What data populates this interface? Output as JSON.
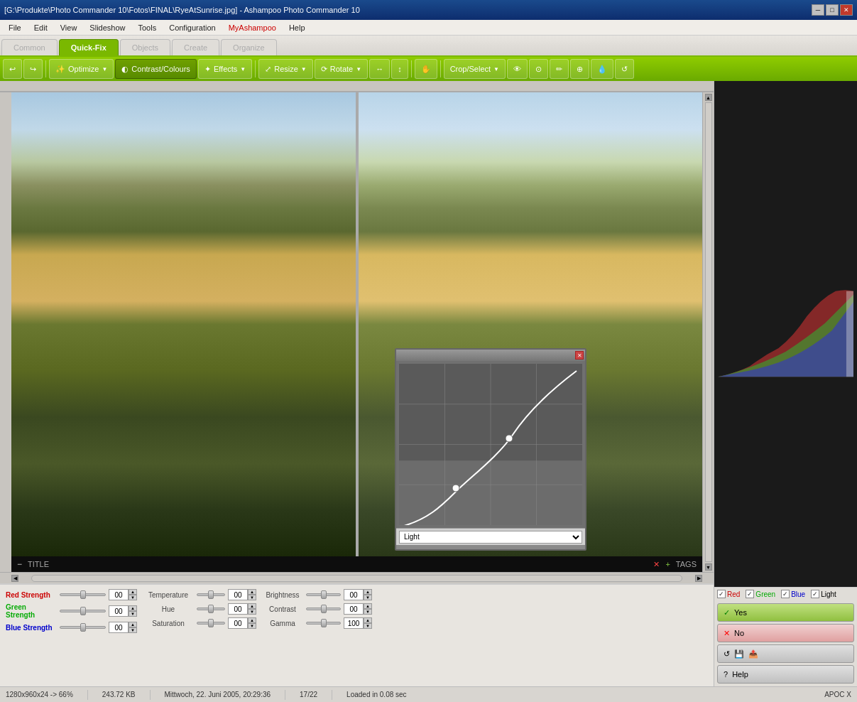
{
  "titlebar": {
    "text": "[G:\\Produkte\\Photo Commander 10\\Fotos\\FINAL\\RyeAtSunrise.jpg] - Ashampoo Photo Commander 10",
    "min": "─",
    "max": "□",
    "close": "✕"
  },
  "menubar": {
    "items": [
      "File",
      "Edit",
      "View",
      "Slideshow",
      "Tools",
      "Configuration",
      "MyAshampoo",
      "Help"
    ],
    "special_index": 6
  },
  "tabs": {
    "items": [
      "Common",
      "Quick-Fix",
      "Objects",
      "Create",
      "Organize"
    ],
    "active": 1
  },
  "toolbar": {
    "undo_icon": "↩",
    "redo_icon": "↪",
    "optimize": "Optimize",
    "contrast_colours": "Contrast/Colours",
    "effects": "Effects",
    "resize": "Resize",
    "rotate": "Rotate",
    "crop": "Crop/Select"
  },
  "sliders": {
    "red_strength": {
      "label": "Red Strength",
      "value": "00"
    },
    "green_strength": {
      "label": "Green Strength",
      "value": "00"
    },
    "blue_strength": {
      "label": "Blue Strength",
      "value": "00"
    },
    "temperature": {
      "label": "Temperature",
      "value": "00"
    },
    "hue": {
      "label": "Hue",
      "value": "00"
    },
    "saturation": {
      "label": "Saturation",
      "value": "00"
    },
    "brightness": {
      "label": "Brightness",
      "value": "00"
    },
    "contrast": {
      "label": "Contrast",
      "value": "00"
    },
    "gamma": {
      "label": "Gamma",
      "value": "100"
    }
  },
  "curves": {
    "dropdown_value": "Light",
    "close_icon": "✕"
  },
  "checkboxes": {
    "red": {
      "label": "Red",
      "checked": true
    },
    "green": {
      "label": "Green",
      "checked": true
    },
    "blue": {
      "label": "Blue",
      "checked": true
    },
    "light": {
      "label": "Light",
      "checked": true
    }
  },
  "action_buttons": {
    "yes": "Yes",
    "no": "No",
    "reset_icon": "↺",
    "save_icon": "💾",
    "export_icon": "📤",
    "help": "Help"
  },
  "statusbar": {
    "dimensions": "1280x960x24 -> 66%",
    "filesize": "243.72 KB",
    "date": "Mittwoch, 22. Juni 2005, 20:29:36",
    "position": "17/22",
    "loaded": "Loaded in 0.08 sec",
    "apoc": "APOC X"
  },
  "overlay": {
    "title": "TITLE",
    "tags": "TAGS"
  },
  "histogram_colors": {
    "red": "#cc3333",
    "green": "#33aa33",
    "blue": "#3333cc"
  }
}
